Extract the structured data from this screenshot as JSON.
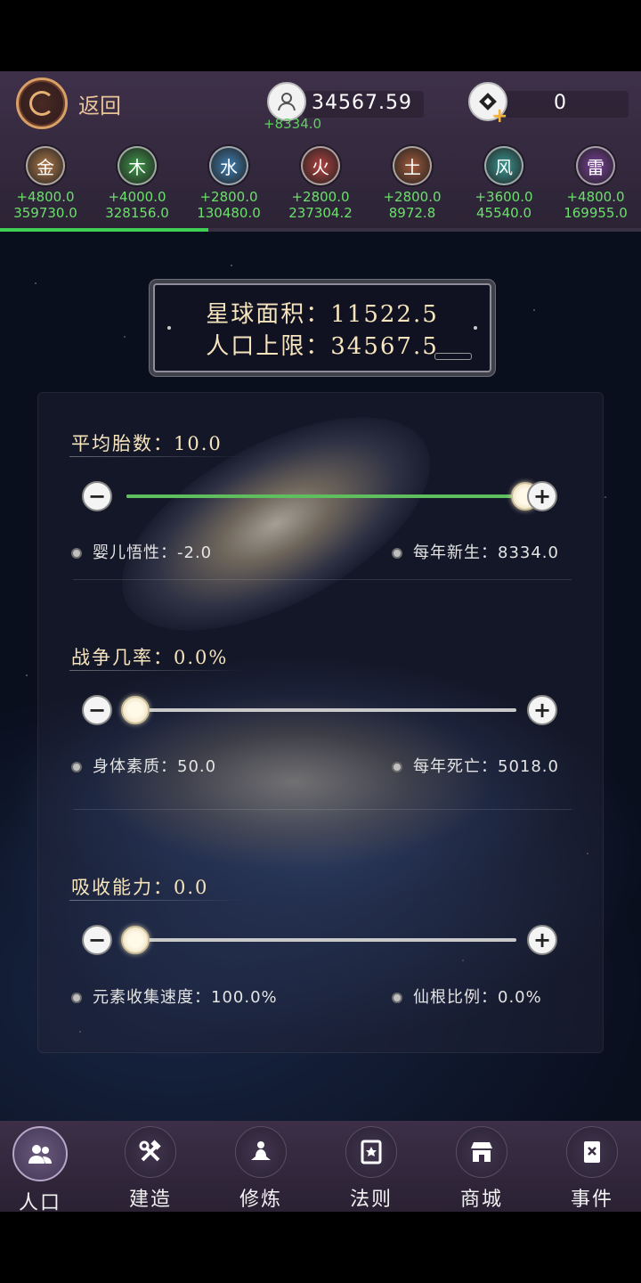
{
  "header": {
    "back_label": "返回",
    "population": {
      "value": "34567.59",
      "delta": "+8334.0"
    },
    "gem": {
      "value": "0"
    }
  },
  "elements": [
    {
      "name": "金",
      "delta": "+4800.0",
      "total": "359730.0",
      "color": "#b07a4a"
    },
    {
      "name": "木",
      "delta": "+4000.0",
      "total": "328156.0",
      "color": "#3f9a4a"
    },
    {
      "name": "水",
      "delta": "+2800.0",
      "total": "130480.0",
      "color": "#3f7fb2"
    },
    {
      "name": "火",
      "delta": "+2800.0",
      "total": "237304.2",
      "color": "#b2423f"
    },
    {
      "name": "土",
      "delta": "+2800.0",
      "total": "8972.8",
      "color": "#a35a3a"
    },
    {
      "name": "风",
      "delta": "+3600.0",
      "total": "45540.0",
      "color": "#3a9a95"
    },
    {
      "name": "雷",
      "delta": "+4800.0",
      "total": "169955.0",
      "color": "#7a3f9a"
    }
  ],
  "element_progress": 0.325,
  "info": {
    "area": "星球面积：11522.5",
    "pop_limit": "人口上限：34567.5"
  },
  "sections": {
    "birth": {
      "title": "平均胎数：10.0",
      "level": 1.0,
      "stat_left": "婴儿悟性：-2.0",
      "stat_right": "每年新生：8334.0"
    },
    "war": {
      "title": "战争几率：0.0%",
      "level": 0.0,
      "stat_left": "身体素质：50.0",
      "stat_right": "每年死亡：5018.0"
    },
    "absorb": {
      "title": "吸收能力：0.0",
      "level": 0.0,
      "stat_left": "元素收集速度：100.0%",
      "stat_right": "仙根比例：0.0%"
    }
  },
  "nav": [
    {
      "label": "人口",
      "icon": "people-icon",
      "active": true
    },
    {
      "label": "建造",
      "icon": "hammer-wrench-icon",
      "active": false
    },
    {
      "label": "修炼",
      "icon": "meditation-icon",
      "active": false
    },
    {
      "label": "法则",
      "icon": "scroll-icon",
      "active": false
    },
    {
      "label": "商城",
      "icon": "shop-icon",
      "active": false
    },
    {
      "label": "事件",
      "icon": "book-icon",
      "active": false
    }
  ]
}
